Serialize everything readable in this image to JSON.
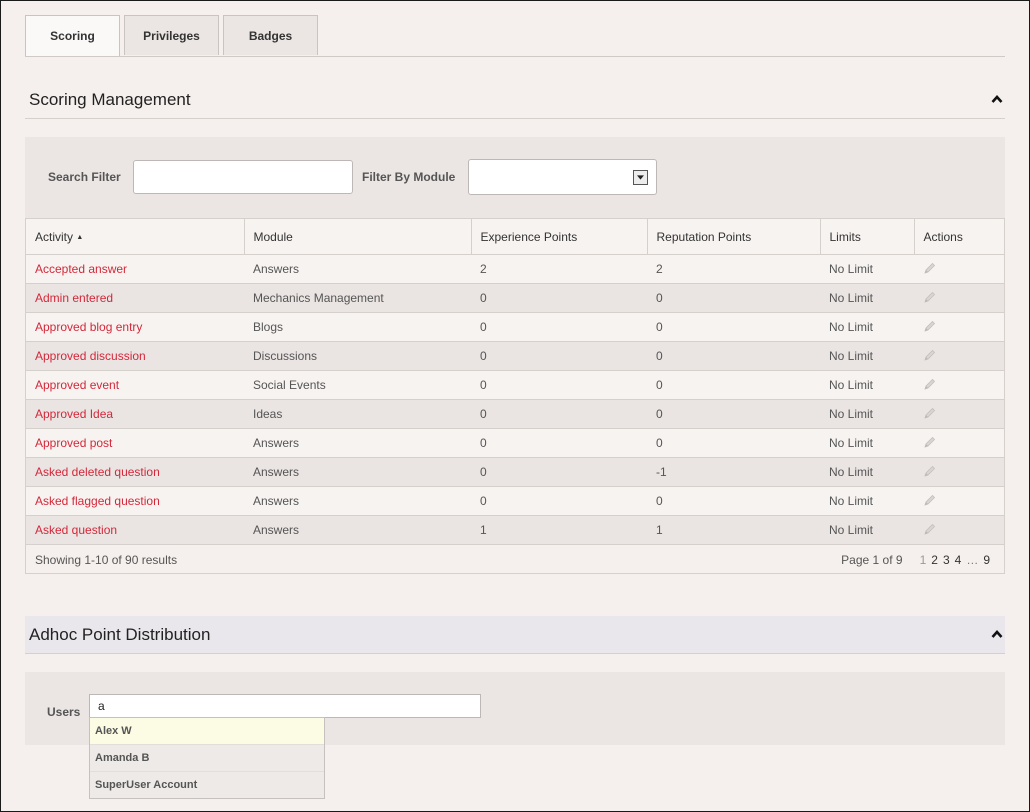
{
  "tabs": [
    {
      "label": "Scoring",
      "active": true
    },
    {
      "label": "Privileges",
      "active": false
    },
    {
      "label": "Badges",
      "active": false
    }
  ],
  "scoring": {
    "title": "Scoring Management",
    "search_filter_label": "Search Filter",
    "search_value": "",
    "module_filter_label": "Filter By Module",
    "module_value": "",
    "columns": [
      "Activity",
      "Module",
      "Experience Points",
      "Reputation Points",
      "Limits",
      "Actions"
    ],
    "sort_indicator": "▲",
    "rows": [
      {
        "activity": "Accepted answer",
        "module": "Answers",
        "xp": "2",
        "rep": "2",
        "limit": "No Limit"
      },
      {
        "activity": "Admin entered",
        "module": "Mechanics Management",
        "xp": "0",
        "rep": "0",
        "limit": "No Limit"
      },
      {
        "activity": "Approved blog entry",
        "module": "Blogs",
        "xp": "0",
        "rep": "0",
        "limit": "No Limit"
      },
      {
        "activity": "Approved discussion",
        "module": "Discussions",
        "xp": "0",
        "rep": "0",
        "limit": "No Limit"
      },
      {
        "activity": "Approved event",
        "module": "Social Events",
        "xp": "0",
        "rep": "0",
        "limit": "No Limit"
      },
      {
        "activity": "Approved Idea",
        "module": "Ideas",
        "xp": "0",
        "rep": "0",
        "limit": "No Limit"
      },
      {
        "activity": "Approved post",
        "module": "Answers",
        "xp": "0",
        "rep": "0",
        "limit": "No Limit"
      },
      {
        "activity": "Asked deleted question",
        "module": "Answers",
        "xp": "0",
        "rep": "-1",
        "limit": "No Limit"
      },
      {
        "activity": "Asked flagged question",
        "module": "Answers",
        "xp": "0",
        "rep": "0",
        "limit": "No Limit"
      },
      {
        "activity": "Asked question",
        "module": "Answers",
        "xp": "1",
        "rep": "1",
        "limit": "No Limit"
      }
    ],
    "results_text": "Showing 1-10 of 90 results",
    "pager": {
      "label": "Page 1 of 9",
      "pages": [
        "1",
        "2",
        "3",
        "4",
        "…",
        "9"
      ],
      "current": "1"
    }
  },
  "adhoc": {
    "title": "Adhoc Point Distribution",
    "users_label": "Users",
    "users_value": "a",
    "suggestions": [
      "Alex W",
      "Amanda B",
      "SuperUser Account"
    ]
  },
  "icons": {
    "collapse": "chevron-up-icon",
    "edit": "pencil-icon",
    "dropdown": "dropdown-arrow-icon"
  }
}
